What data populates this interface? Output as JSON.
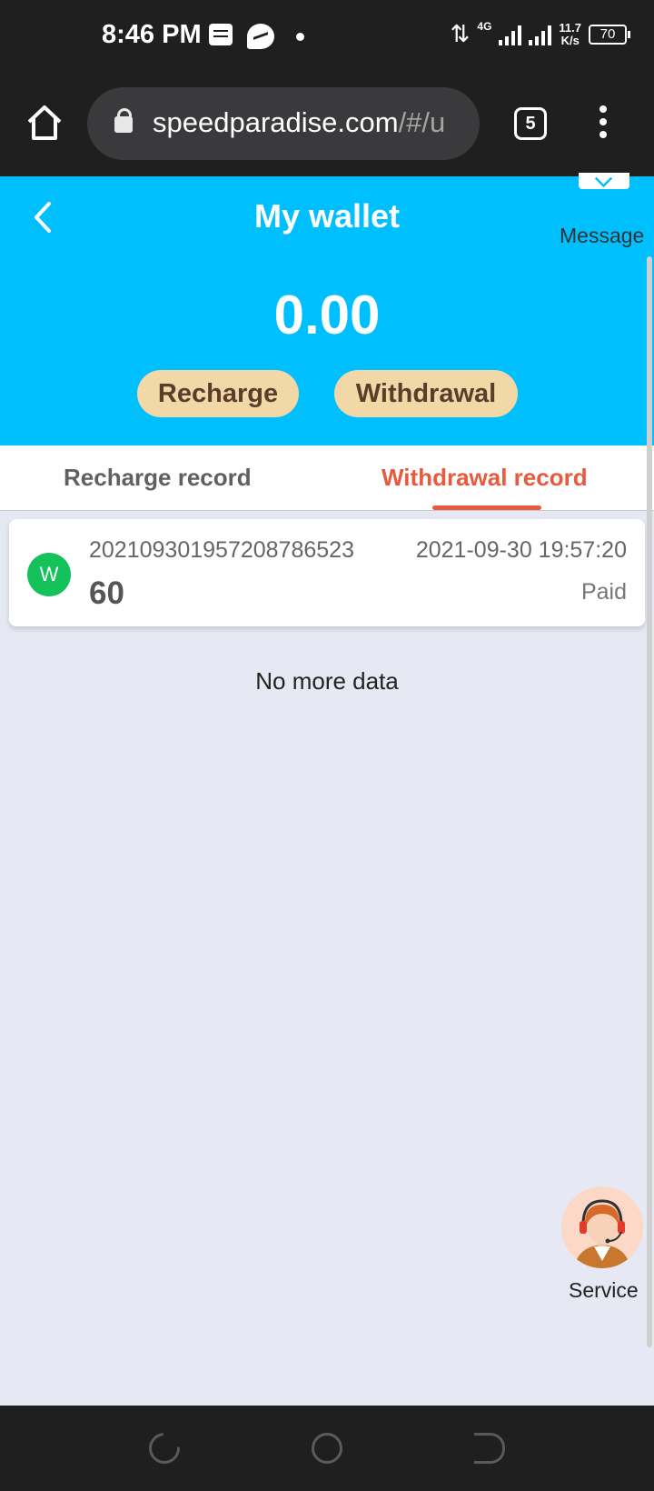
{
  "status_bar": {
    "time": "8:46 PM",
    "network": "4G",
    "speed_value": "11.7",
    "speed_unit": "K/s",
    "battery": "70",
    "icons": [
      "news-icon",
      "messenger-icon",
      "dot-icon",
      "data-arrows-icon",
      "signal-icon",
      "battery-icon"
    ]
  },
  "browser": {
    "url_main": "speedparadise.com",
    "url_rest": "/#/u",
    "tab_count": "5",
    "icons": [
      "home-icon",
      "lock-icon",
      "tabs-icon",
      "overflow-menu-icon"
    ]
  },
  "header": {
    "title": "My wallet",
    "message_label": "Message",
    "balance": "0.00",
    "recharge_label": "Recharge",
    "withdrawal_label": "Withdrawal",
    "background_color": "#00bfff",
    "pill_color": "#f2d7a7"
  },
  "tabs": {
    "items": [
      {
        "label": "Recharge record",
        "active": false
      },
      {
        "label": "Withdrawal record",
        "active": true
      }
    ],
    "active_color": "#e85a3f"
  },
  "records": [
    {
      "avatar_letter": "W",
      "order_no": "202109301957208786523",
      "amount": "60",
      "time": "2021-09-30 19:57:20",
      "status": "Paid"
    }
  ],
  "list_end_text": "No more data",
  "service": {
    "label": "Service",
    "icon": "customer-service-agent-icon"
  },
  "nav_bar": {
    "icons": [
      "recent-apps-icon",
      "home-circle-icon",
      "back-icon"
    ]
  }
}
